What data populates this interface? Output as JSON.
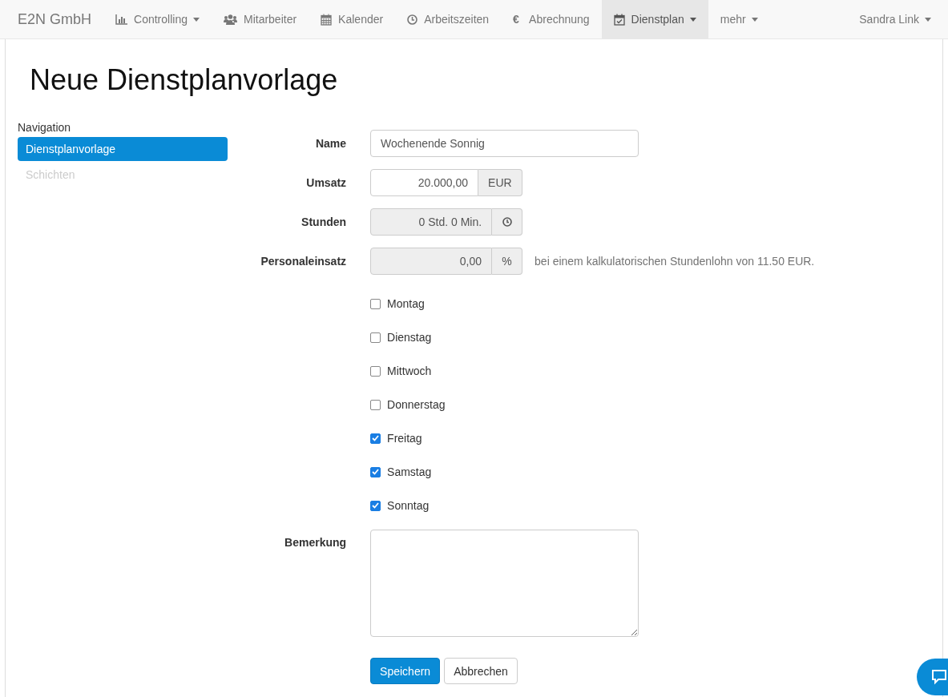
{
  "brand": "E2N GmbH",
  "nav": [
    {
      "label": "Controlling",
      "dropdown": true,
      "selected": false
    },
    {
      "label": "Mitarbeiter",
      "dropdown": false,
      "selected": false
    },
    {
      "label": "Kalender",
      "dropdown": false,
      "selected": false
    },
    {
      "label": "Arbeitszeiten",
      "dropdown": false,
      "selected": false
    },
    {
      "label": "Abrechnung",
      "glyph": "€",
      "dropdown": false,
      "selected": false
    },
    {
      "label": "Dienstplan",
      "dropdown": true,
      "selected": true
    },
    {
      "label": "mehr",
      "dropdown": true,
      "selected": false
    }
  ],
  "user": {
    "label": "Sandra Link",
    "dropdown": true
  },
  "title": "Neue Dienstplanvorlage",
  "sidebar": {
    "heading": "Navigation",
    "items": [
      {
        "label": "Dienstplanvorlage",
        "selected": true,
        "disabled": false
      },
      {
        "label": "Schichten",
        "selected": false,
        "disabled": true
      }
    ]
  },
  "fields": [
    {
      "label": "Name",
      "kind": "text",
      "value": "Wochenende Sonnig",
      "disabled": false
    },
    {
      "label": "Umsatz",
      "kind": "addon_text",
      "value": "20.000,00",
      "addon": "EUR",
      "disabled": false
    },
    {
      "label": "Stunden",
      "kind": "addon_clock",
      "value": "0 Std. 0 Min.",
      "disabled": true
    },
    {
      "label": "Personaleinsatz",
      "kind": "addon_text",
      "value": "0,00",
      "addon": "%",
      "disabled": true,
      "hint": "bei einem kalkulatorischen Stundenlohn von 11.50 EUR."
    }
  ],
  "days": [
    {
      "label": "Montag",
      "checked": false
    },
    {
      "label": "Dienstag",
      "checked": false
    },
    {
      "label": "Mittwoch",
      "checked": false
    },
    {
      "label": "Donnerstag",
      "checked": false
    },
    {
      "label": "Freitag",
      "checked": true
    },
    {
      "label": "Samstag",
      "checked": true
    },
    {
      "label": "Sonntag",
      "checked": true
    }
  ],
  "remark": {
    "label": "Bemerkung"
  },
  "buttons": [
    {
      "label": "Speichern",
      "kind": "primary"
    },
    {
      "label": "Abbrechen",
      "kind": "default"
    }
  ]
}
